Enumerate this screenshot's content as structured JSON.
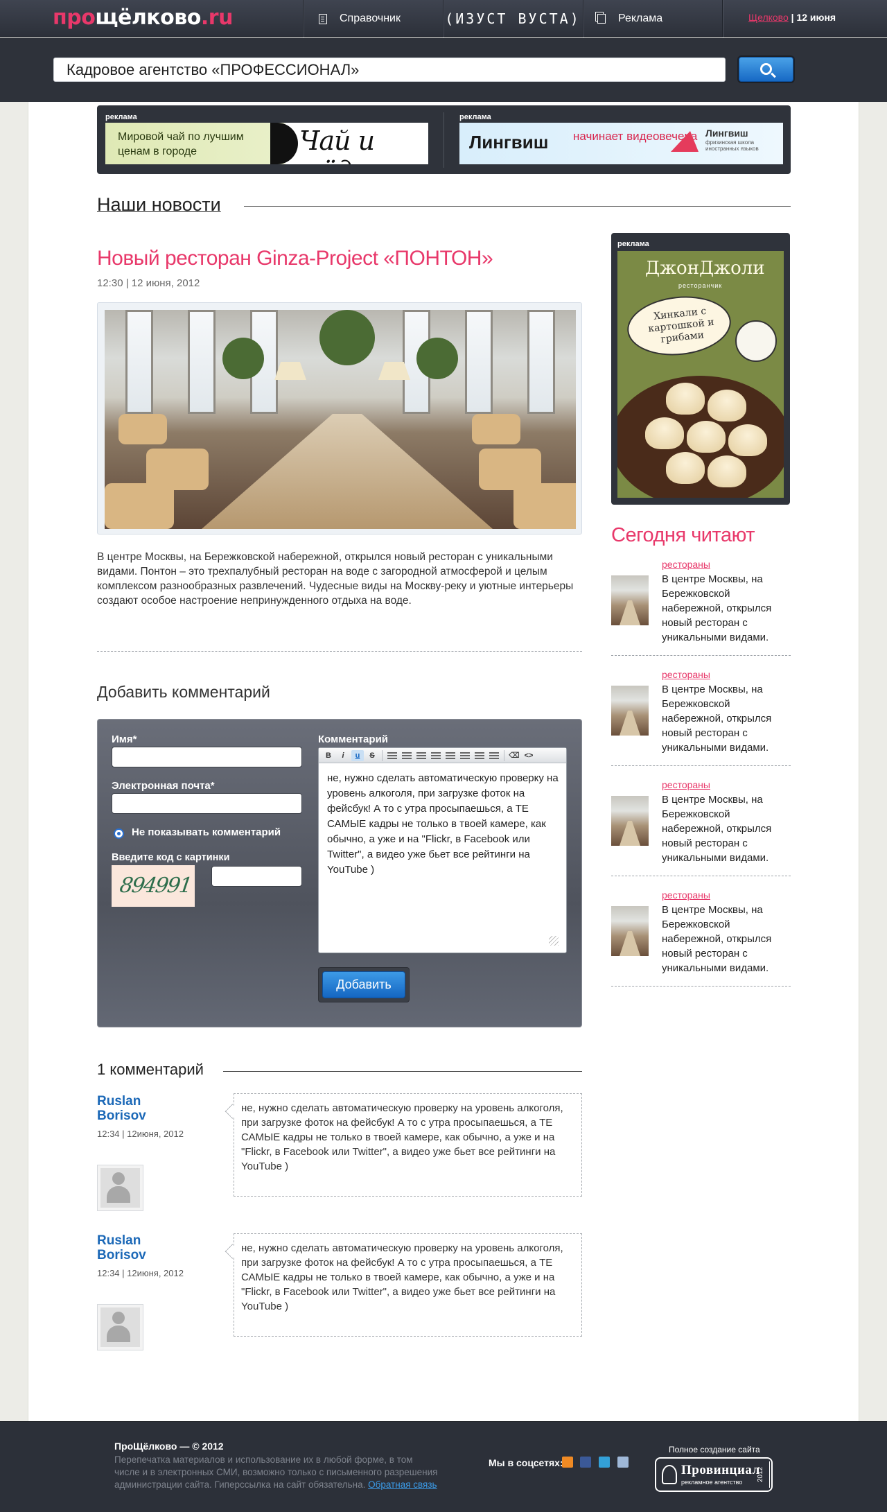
{
  "header": {
    "logo": {
      "part1": "про",
      "part2": "щёлково",
      "part3": ".ru"
    },
    "nav": [
      {
        "label": "Справочник",
        "icon": "document-icon"
      },
      {
        "label": "Реклама",
        "icon": "copy-icon"
      }
    ],
    "brand_center": "(ИЗУСТ ВУСТА)",
    "city": "Щелково",
    "date": "12 июня",
    "date_separator": "|"
  },
  "search": {
    "value": "Кадровое агентство «ПРОФЕССИОНАЛ»",
    "button_icon": "search-icon"
  },
  "ads_top": {
    "label": "реклама",
    "banner1": {
      "text": "Мировой чай по лучшим ценам в городе",
      "brand": "Чай и мёд"
    },
    "banner2": {
      "brand": "Лингвиш",
      "text": "начинает видеовечера",
      "brand2": "Лингвиш",
      "sub": "фризинская школа иностранных языков"
    }
  },
  "news": {
    "heading": "Наши новости",
    "article": {
      "title": "Новый ресторан Ginza-Project «ПОНТОН»",
      "meta": "12:30 | 12 июня, 2012",
      "text": "В центре Москвы, на Бережковской набережной, открылся новый ресторан с уникальными видами. Понтон – это трехпалубный ресторан на воде с загородной атмосферой и целым комплексом разнообразных развлечений. Чудесные виды на Москву-реку и уютные интерьеры создают особое настроение непринужденного отдыха на воде."
    }
  },
  "comment_form": {
    "heading": "Добавить комментарий",
    "name_label": "Имя*",
    "email_label": "Электронная почта*",
    "hide_label": "Не показывать комментарий",
    "captcha_label": "Введите код с картинки",
    "captcha_code": "894991",
    "comment_label": "Комментарий",
    "comment_value": "не, нужно сделать автоматическую проверку на уровень алкоголя, при загрузке фоток на фейсбук! А то с утра просыпаешься, а ТЕ САМЫЕ кадры не только в твоей камере, как обычно, а уже и на \"Flickr, в Facebook или Twitter\", а видео уже бьет все рейтинги на YouTube )",
    "toolbar": {
      "bold": "B",
      "italic": "i",
      "underline": "u",
      "strike": "S"
    },
    "submit": "Добавить"
  },
  "comments": {
    "heading": "1 комментарий",
    "items": [
      {
        "author": "Ruslan Borisov",
        "date": "12:34 | 12июня, 2012",
        "text": "не, нужно сделать автоматическую проверку на уровень алкоголя, при загрузке фоток на фейсбук! А то с утра просыпаешься, а ТЕ САМЫЕ кадры не только в твоей камере, как обычно, а уже и на \"Flickr, в Facebook или Twitter\", а видео уже бьет все рейтинги на YouTube )"
      },
      {
        "author": "Ruslan Borisov",
        "date": "12:34 | 12июня, 2012",
        "text": "не, нужно сделать автоматическую проверку на уровень алкоголя, при загрузке фоток на фейсбук! А то с утра просыпаешься, а ТЕ САМЫЕ кадры не только в твоей камере, как обычно, а уже и на \"Flickr, в Facebook или Twitter\", а видео уже бьет все рейтинги на YouTube )"
      }
    ]
  },
  "sidebar": {
    "ad_label": "реклама",
    "ad": {
      "brand": "ДжонДжоли",
      "sub": "ресторанчик",
      "speech": "Хинкали с картошкой и грибами"
    },
    "today_heading": "Сегодня читают",
    "today": [
      {
        "category": "рестораны",
        "text": "В центре Москвы, на Бережковской набережной, открылся новый ресторан с уникальными видами."
      },
      {
        "category": "рестораны",
        "text": "В центре Москвы, на Бережковской набережной, открылся новый ресторан с уникальными видами."
      },
      {
        "category": "рестораны",
        "text": "В центре Москвы, на Бережковской набережной, открылся новый ресторан с уникальными видами."
      },
      {
        "category": "рестораны",
        "text": "В центре Москвы, на Бережковской набережной, открылся новый ресторан с уникальными видами."
      }
    ]
  },
  "footer": {
    "copyright": "ПроЩёлково — © 2012",
    "note": "Перепечатка материалов и использование их в любой форме, в том числе и в электронных СМИ, возможно только с письменного разрешения администрации сайта. Гиперссылка на сайт обязательна.",
    "feedback": "Обратная связь",
    "social_label": "Мы в соцсетях:",
    "social_icons": [
      "rss-icon",
      "facebook-icon",
      "twitter-icon",
      "delicious-icon"
    ],
    "social_colors": [
      "#f08a24",
      "#3b5998",
      "#33a0d8",
      "#9fb8d8"
    ],
    "created_label": "Полное создание сайта",
    "agency": "Провинциал",
    "agency_sub": "рекламное агентство",
    "agency_year": "2012"
  },
  "colors": {
    "accent": "#e8386a",
    "link": "#1b68b7",
    "button": "#1769c4"
  }
}
